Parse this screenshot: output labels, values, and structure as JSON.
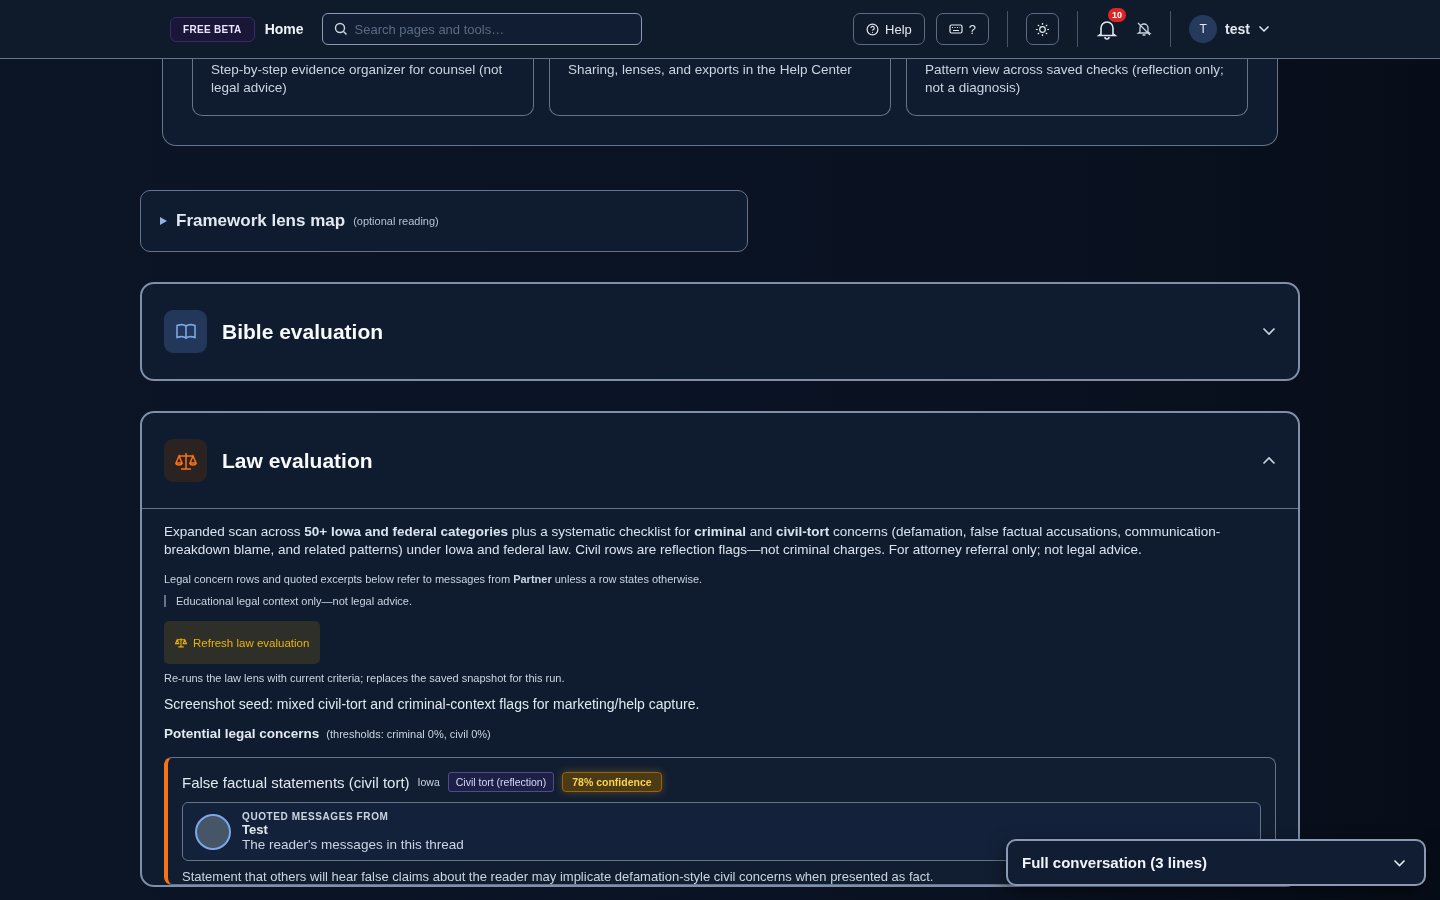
{
  "header": {
    "badge": "FREE BETA",
    "home": "Home",
    "search": {
      "placeholder": "Search pages and tools…"
    },
    "help": "Help",
    "shortcuts": "?",
    "notifications": "10",
    "user": {
      "initial": "T",
      "name": "test"
    }
  },
  "tool_cards": [
    {
      "description": "Step-by-step evidence organizer for counsel (not legal advice)"
    },
    {
      "description": "Sharing, lenses, and exports in the Help Center"
    },
    {
      "description": "Pattern view across saved checks (reflection only; not a diagnosis)"
    }
  ],
  "framework": {
    "title": "Framework lens map",
    "note": "(optional reading)",
    "expanded": false
  },
  "sections": [
    {
      "kind": "bible",
      "title": "Bible evaluation",
      "expanded": false
    },
    {
      "kind": "law",
      "title": "Law evaluation",
      "expanded": true
    }
  ],
  "law": {
    "intro": "Expanded scan across **50+ Iowa and federal categories** plus a systematic checklist for **criminal** and **civil-tort** concerns (defamation, false factual accusations, communication-breakdown blame, and related patterns) under Iowa and federal law. Civil rows are reflection flags—not criminal charges. For attorney referral only; not legal advice.",
    "scope": "Legal concern rows and quoted excerpts below refer to messages from **Partner** unless a row states otherwise.",
    "disclaimer": "Educational legal context only—not legal advice.",
    "refresh_button": "Refresh law evaluation",
    "refresh_hint": "Re-runs the law lens with current criteria; replaces the saved snapshot for this run.",
    "seed": "Screenshot seed: mixed civil-tort and criminal-context flags for marketing/help capture.",
    "concerns_title": "Potential legal concerns",
    "thresholds": "(thresholds: criminal 0%, civil 0%)",
    "concerns": [
      {
        "title": "False factual statements (civil tort)",
        "jurisdiction": "Iowa",
        "tag": "Civil tort (reflection)",
        "confidence": "78% confidence",
        "color": "#f97316",
        "quoted": {
          "label": "QUOTED MESSAGES FROM",
          "name": "Test",
          "description": "The reader's messages in this thread"
        },
        "summary": "Statement that others will hear false claims about the reader may implicate defamation-style civil concerns when presented as fact."
      }
    ]
  },
  "conversation": {
    "title": "Full conversation (3 lines)",
    "expanded": false
  }
}
